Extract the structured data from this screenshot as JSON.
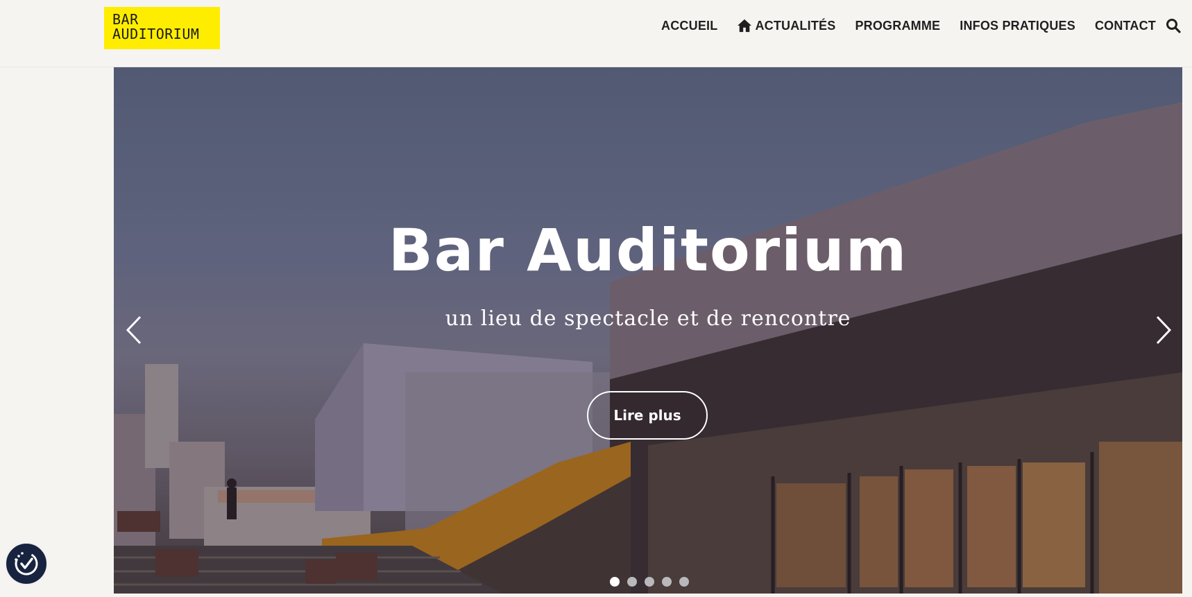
{
  "logo": {
    "line1": "BAR",
    "line2": "AUDITORIUM",
    "bg_color": "#ffed00"
  },
  "nav": {
    "items": [
      {
        "label": "ACCUEIL"
      },
      {
        "label": "ACTUALITÉS",
        "icon": "home-icon"
      },
      {
        "label": "PROGRAMME"
      },
      {
        "label": "INFOS PRATIQUES"
      },
      {
        "label": "CONTACT"
      }
    ],
    "search_icon": "search-icon"
  },
  "hero": {
    "title": "Bar Auditorium",
    "subtitle": "un lieu de spectacle et de rencontre",
    "cta_label": "Lire plus",
    "prev_icon": "chevron-left-icon",
    "next_icon": "chevron-right-icon",
    "slide_count": 5,
    "active_slide": 1
  },
  "accessibility": {
    "icon": "accessibility-check-icon",
    "color": "#18233f"
  }
}
